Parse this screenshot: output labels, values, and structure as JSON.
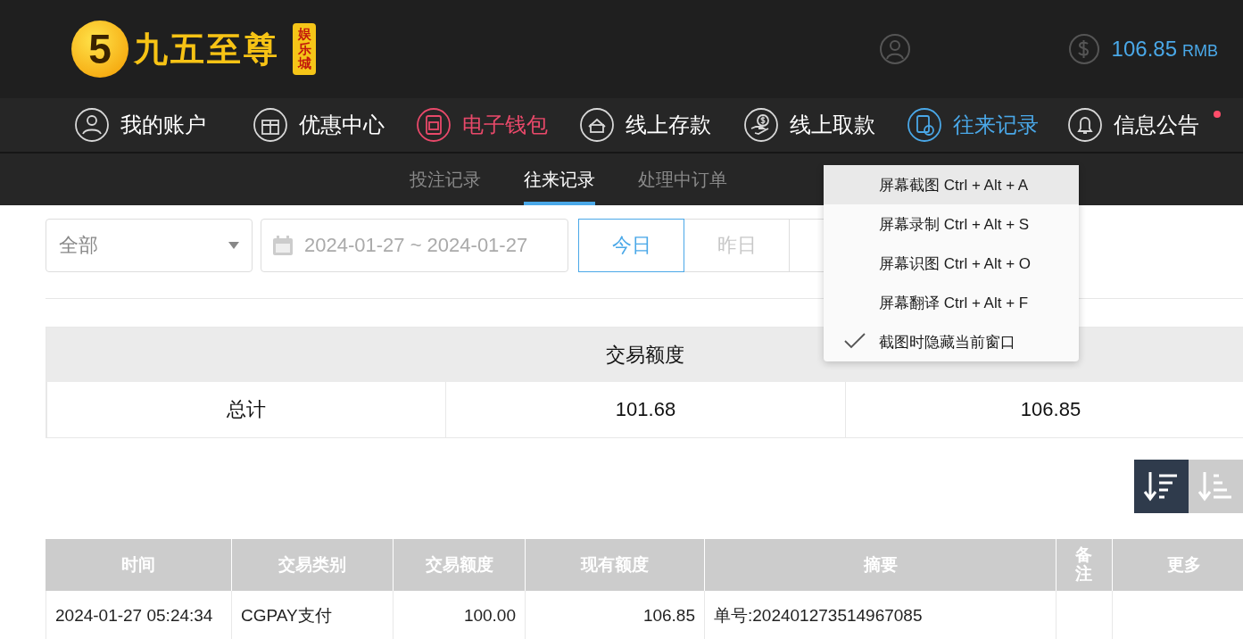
{
  "header": {
    "logo": {
      "mark": "5",
      "name": "九五至尊",
      "tag": "娱乐城"
    },
    "balance": {
      "amount": "106.85",
      "currency": "RMB"
    }
  },
  "nav": [
    {
      "label": "我的账户",
      "color": "#ffffff"
    },
    {
      "label": "优惠中心",
      "color": "#ffffff"
    },
    {
      "label": "电子钱包",
      "color": "#e9496a"
    },
    {
      "label": "线上存款",
      "color": "#ffffff"
    },
    {
      "label": "线上取款",
      "color": "#ffffff"
    },
    {
      "label": "往来记录",
      "color": "#4aa8e8"
    },
    {
      "label": "信息公告",
      "color": "#ffffff",
      "badge": true
    }
  ],
  "subtabs": [
    {
      "label": "投注记录",
      "selected": false
    },
    {
      "label": "往来记录",
      "selected": true
    },
    {
      "label": "处理中订单",
      "selected": false
    }
  ],
  "filters": {
    "type_select": "全部",
    "date_range": "2024-01-27 ~ 2024-01-27",
    "ranges": [
      {
        "label": "今日",
        "selected": true
      },
      {
        "label": "昨日",
        "selected": false
      },
      {
        "selected": false
      }
    ]
  },
  "summary": {
    "columns": [
      "交易额度"
    ],
    "row": [
      "总计",
      "101.68",
      "106.85"
    ]
  },
  "sort_buttons": [
    {
      "kind": "desc",
      "selected": true
    },
    {
      "kind": "asc",
      "selected": false
    }
  ],
  "table": {
    "columns": [
      "时间",
      "交易类别",
      "交易额度",
      "现有额度",
      "摘要",
      "备注",
      "更多"
    ],
    "rows": [
      [
        "2024-01-27 05:24:34",
        "CGPAY支付",
        "100.00",
        "106.85",
        "单号:202401273514967085",
        "",
        ""
      ]
    ]
  },
  "context_menu": [
    {
      "label": "屏幕截图 Ctrl + Alt + A",
      "checked": false,
      "highlighted": true
    },
    {
      "label": "屏幕录制 Ctrl + Alt + S",
      "checked": false,
      "highlighted": false
    },
    {
      "label": "屏幕识图 Ctrl + Alt + O",
      "checked": false,
      "highlighted": false
    },
    {
      "label": "屏幕翻译 Ctrl + Alt + F",
      "checked": false,
      "highlighted": false
    },
    {
      "label": "截图时隐藏当前窗口",
      "checked": true,
      "highlighted": false
    }
  ]
}
